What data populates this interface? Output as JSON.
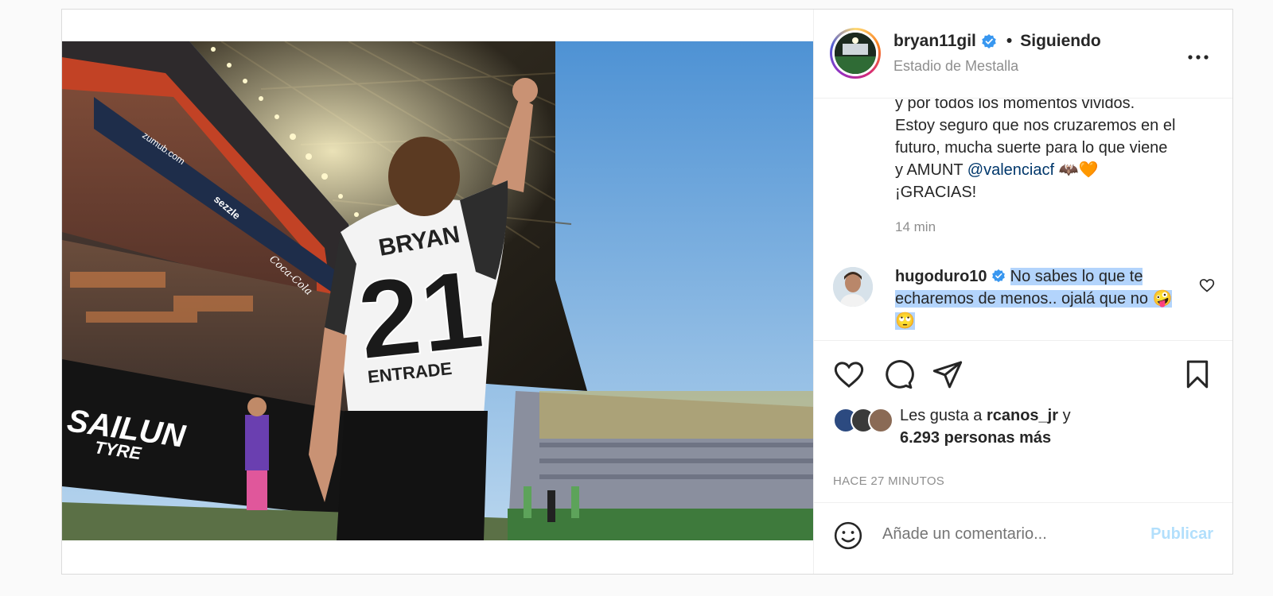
{
  "header": {
    "username": "bryan11gil",
    "separator": "•",
    "follow_status": "Siguiendo",
    "location": "Estadio de Mestalla",
    "more_icon": "more-horizontal-icon"
  },
  "caption": {
    "line1": "y por todos los momentos vividos.",
    "line2": "Estoy seguro que nos cruzaremos en el",
    "line3": "futuro, mucha suerte para lo que viene",
    "line4_prefix": "y AMUNT ",
    "mention": "@valenciacf",
    "line4_emoji": "🦇🧡",
    "line5": "¡GRACIAS!",
    "time": "14 min"
  },
  "comment": {
    "username": "hugoduro10",
    "text": "No sabes lo que te echaremos de menos.. ojalá que no 🤪🙄"
  },
  "likes": {
    "prefix": "Les gusta a ",
    "user": "rcanos_jr",
    "mid": " y",
    "others": "6.293 personas más"
  },
  "posted_ago": "HACE 27 MINUTOS",
  "add_comment": {
    "placeholder": "Añade un comentario...",
    "publish_label": "Publicar"
  },
  "photo": {
    "jersey_name": "BRYAN",
    "jersey_number": "21",
    "sponsor": "ENTRADE",
    "board_text_1": "SAILUN",
    "board_text_2": "TYRE",
    "banner_1": "zumub.com",
    "banner_2": "sezzle",
    "banner_3": "Coca-Cola"
  },
  "colors": {
    "link": "#00376b",
    "publish_disabled": "#b2dffc",
    "verified": "#3897f0",
    "highlight": "#b3d4fc"
  }
}
